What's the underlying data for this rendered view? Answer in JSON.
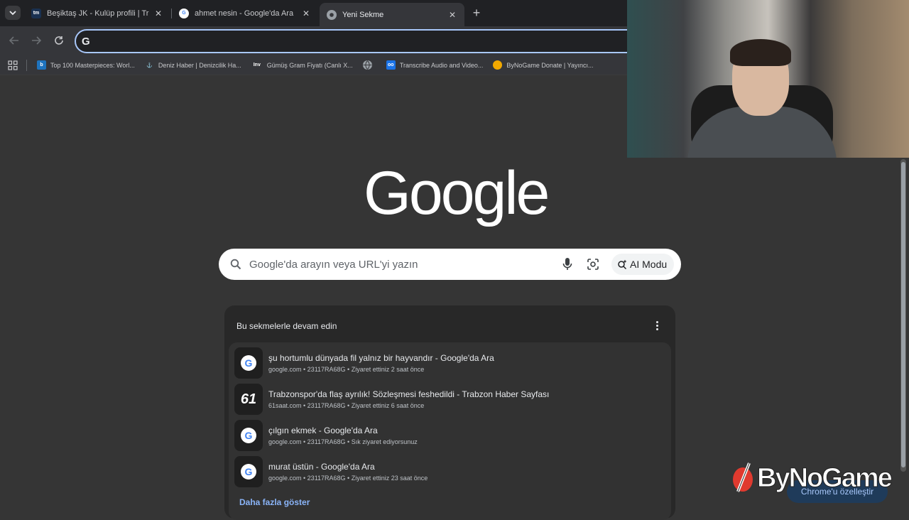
{
  "tabs": [
    {
      "title": "Beşiktaş JK - Kulüp profili | Transfermarkt",
      "favicon": "tm",
      "active": false
    },
    {
      "title": "ahmet nesin - Google'da Ara",
      "favicon": "G",
      "active": false
    },
    {
      "title": "Yeni Sekme",
      "favicon": "chrome",
      "active": true
    }
  ],
  "omnibox": {
    "prefix": "G",
    "value": ""
  },
  "bookmarks": [
    {
      "label": "Top 100 Masterpieces: Worl...",
      "icon": "b",
      "color": "#1e73be"
    },
    {
      "label": "Deniz Haber | Denizcilik Ha...",
      "icon": "anchor",
      "color": "#35363a"
    },
    {
      "label": "Gümüş Gram Fiyatı (Canlı X...",
      "icon": "Inv",
      "color": "#35363a"
    },
    {
      "label": "",
      "icon": "globe",
      "color": "#35363a"
    },
    {
      "label": "Transcribe Audio and Video...",
      "icon": "oo",
      "color": "#1a73e8"
    },
    {
      "label": "ByNoGame Donate | Yayıncı...",
      "icon": "bynogame",
      "color": "#35363a"
    }
  ],
  "logo": "Google",
  "search": {
    "placeholder": "Google'da arayın veya URL'yi yazın",
    "ai_mode": "AI Modu"
  },
  "panel": {
    "heading": "Bu sekmelerle devam edin",
    "items": [
      {
        "title": "şu hortumlu dünyada fil yalnız bir hayvandır - Google'da Ara",
        "meta": "google.com • 23117RA68G • Ziyaret ettiniz 2 saat önce",
        "icon": "G"
      },
      {
        "title": "Trabzonspor'da flaş ayrılık! Sözleşmesi feshedildi - Trabzon Haber Sayfası",
        "meta": "61saat.com • 23117RA68G • Ziyaret ettiniz 6 saat önce",
        "icon": "61"
      },
      {
        "title": "çılgın ekmek - Google'da Ara",
        "meta": "google.com • 23117RA68G • Sık ziyaret ediyorsunuz",
        "icon": "G"
      },
      {
        "title": "murat üstün - Google'da Ara",
        "meta": "google.com • 23117RA68G • Ziyaret ettiniz 23 saat önce",
        "icon": "G"
      }
    ],
    "show_more": "Daha fazla göster"
  },
  "customize_label": "Chrome'u özelleştir",
  "watermark": "ByNoGame"
}
